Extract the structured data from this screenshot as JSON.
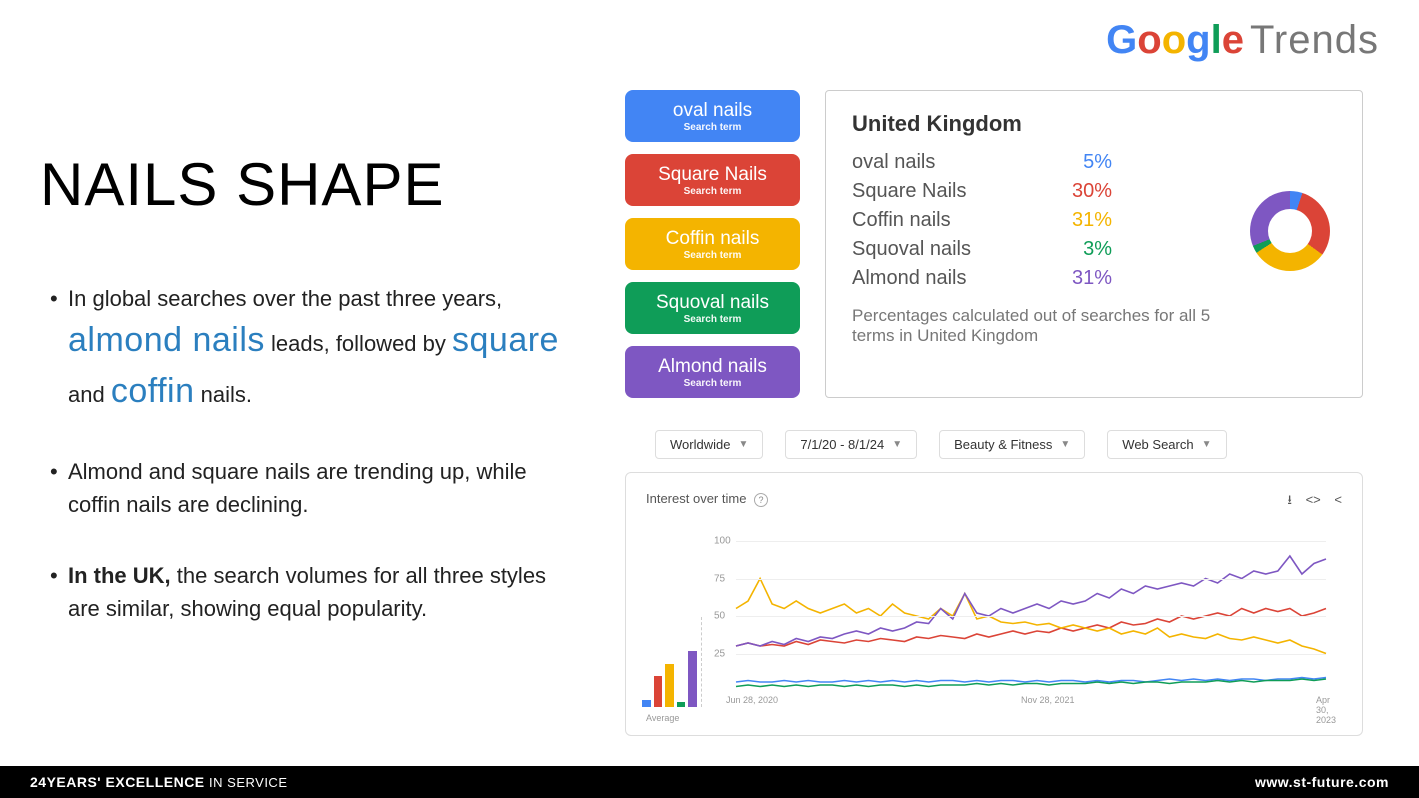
{
  "logo": {
    "g1": "G",
    "g2": "o",
    "g3": "o",
    "g4": "g",
    "g5": "l",
    "g6": "e",
    "trends": "Trends"
  },
  "title": "NAILS SHAPE",
  "bullets": {
    "b1a": "In global searches over the past three years, ",
    "b1b": "almond nails",
    "b1c": " leads, followed by ",
    "b1d": "square",
    "b1e": " and ",
    "b1f": "coffin",
    "b1g": " nails.",
    "b2": "Almond and square nails are trending up, while coffin nails are declining.",
    "b3a": "In the UK,",
    "b3b": " the search volumes for all three styles are similar, showing equal popularity."
  },
  "pills": [
    {
      "label": "oval nails",
      "sub": "Search term",
      "color": "#4285f4"
    },
    {
      "label": "Square Nails",
      "sub": "Search term",
      "color": "#db4437"
    },
    {
      "label": "Coffin nails",
      "sub": "Search term",
      "color": "#f4b400"
    },
    {
      "label": "Squoval nails",
      "sub": "Search term",
      "color": "#0f9d58"
    },
    {
      "label": "Almond nails",
      "sub": "Search term",
      "color": "#7e57c2"
    }
  ],
  "uk": {
    "title": "United Kingdom",
    "rows": [
      {
        "name": "oval nails",
        "pct": "5%",
        "color": "#4285f4"
      },
      {
        "name": "Square Nails",
        "pct": "30%",
        "color": "#db4437"
      },
      {
        "name": "Coffin nails",
        "pct": "31%",
        "color": "#f4b400"
      },
      {
        "name": "Squoval nails",
        "pct": "3%",
        "color": "#0f9d58"
      },
      {
        "name": "Almond nails",
        "pct": "31%",
        "color": "#7e57c2"
      }
    ],
    "note": "Percentages calculated out of searches for all 5 terms in United Kingdom"
  },
  "filters": {
    "region": "Worldwide",
    "date": "7/1/20 - 8/1/24",
    "category": "Beauty & Fitness",
    "type": "Web Search"
  },
  "chart": {
    "title": "Interest over time",
    "avg_label": "Average"
  },
  "chart_data": {
    "type": "line",
    "ylim": [
      0,
      100
    ],
    "yticks": [
      25,
      50,
      75,
      100
    ],
    "x_labels": [
      "Jun 28, 2020",
      "Nov 28, 2021",
      "Apr 30, 2023"
    ],
    "avg_bars": [
      {
        "name": "oval nails",
        "value": 8,
        "color": "#4285f4"
      },
      {
        "name": "Square Nails",
        "value": 35,
        "color": "#db4437"
      },
      {
        "name": "Coffin nails",
        "value": 48,
        "color": "#f4b400"
      },
      {
        "name": "Squoval nails",
        "value": 6,
        "color": "#0f9d58"
      },
      {
        "name": "Almond nails",
        "value": 62,
        "color": "#7e57c2"
      }
    ],
    "series": [
      {
        "name": "oval nails",
        "color": "#4285f4",
        "values": [
          6,
          7,
          6,
          6,
          7,
          6,
          7,
          6,
          6,
          7,
          6,
          7,
          6,
          7,
          6,
          7,
          6,
          7,
          7,
          6,
          7,
          6,
          7,
          7,
          6,
          7,
          6,
          7,
          7,
          6,
          7,
          6,
          7,
          7,
          6,
          7,
          8,
          7,
          8,
          7,
          8,
          7,
          8,
          8,
          7,
          8,
          8,
          9,
          8,
          9
        ]
      },
      {
        "name": "Square Nails",
        "color": "#db4437",
        "values": [
          30,
          32,
          30,
          31,
          30,
          33,
          31,
          34,
          33,
          32,
          34,
          33,
          35,
          34,
          33,
          36,
          35,
          37,
          36,
          35,
          38,
          36,
          38,
          40,
          38,
          40,
          39,
          42,
          40,
          42,
          44,
          42,
          46,
          44,
          45,
          48,
          46,
          50,
          48,
          50,
          52,
          50,
          55,
          52,
          55,
          53,
          55,
          50,
          52,
          55
        ]
      },
      {
        "name": "Coffin nails",
        "color": "#f4b400",
        "values": [
          55,
          60,
          75,
          58,
          55,
          60,
          55,
          52,
          55,
          58,
          52,
          55,
          50,
          58,
          52,
          50,
          48,
          55,
          50,
          65,
          48,
          50,
          46,
          45,
          46,
          44,
          45,
          42,
          44,
          42,
          40,
          42,
          38,
          40,
          38,
          42,
          36,
          38,
          36,
          35,
          38,
          35,
          34,
          36,
          34,
          32,
          34,
          30,
          28,
          25
        ]
      },
      {
        "name": "Squoval nails",
        "color": "#0f9d58",
        "values": [
          3,
          4,
          3,
          4,
          3,
          4,
          3,
          4,
          4,
          3,
          4,
          3,
          4,
          4,
          3,
          4,
          3,
          4,
          4,
          4,
          5,
          4,
          5,
          4,
          5,
          5,
          4,
          5,
          5,
          5,
          6,
          5,
          6,
          5,
          6,
          6,
          5,
          6,
          6,
          6,
          7,
          6,
          7,
          6,
          7,
          7,
          7,
          8,
          7,
          8
        ]
      },
      {
        "name": "Almond nails",
        "color": "#7e57c2",
        "values": [
          30,
          32,
          30,
          33,
          31,
          35,
          33,
          36,
          35,
          38,
          40,
          38,
          42,
          40,
          42,
          46,
          45,
          55,
          48,
          65,
          52,
          50,
          55,
          52,
          55,
          58,
          55,
          60,
          58,
          60,
          65,
          62,
          68,
          65,
          70,
          68,
          70,
          72,
          70,
          75,
          72,
          78,
          75,
          80,
          78,
          80,
          90,
          78,
          85,
          88
        ]
      }
    ]
  },
  "footer": {
    "left_a": "24YEARS' EXCELLENCE",
    "left_b": "IN SERVICE",
    "right": "www.st-future.com"
  }
}
